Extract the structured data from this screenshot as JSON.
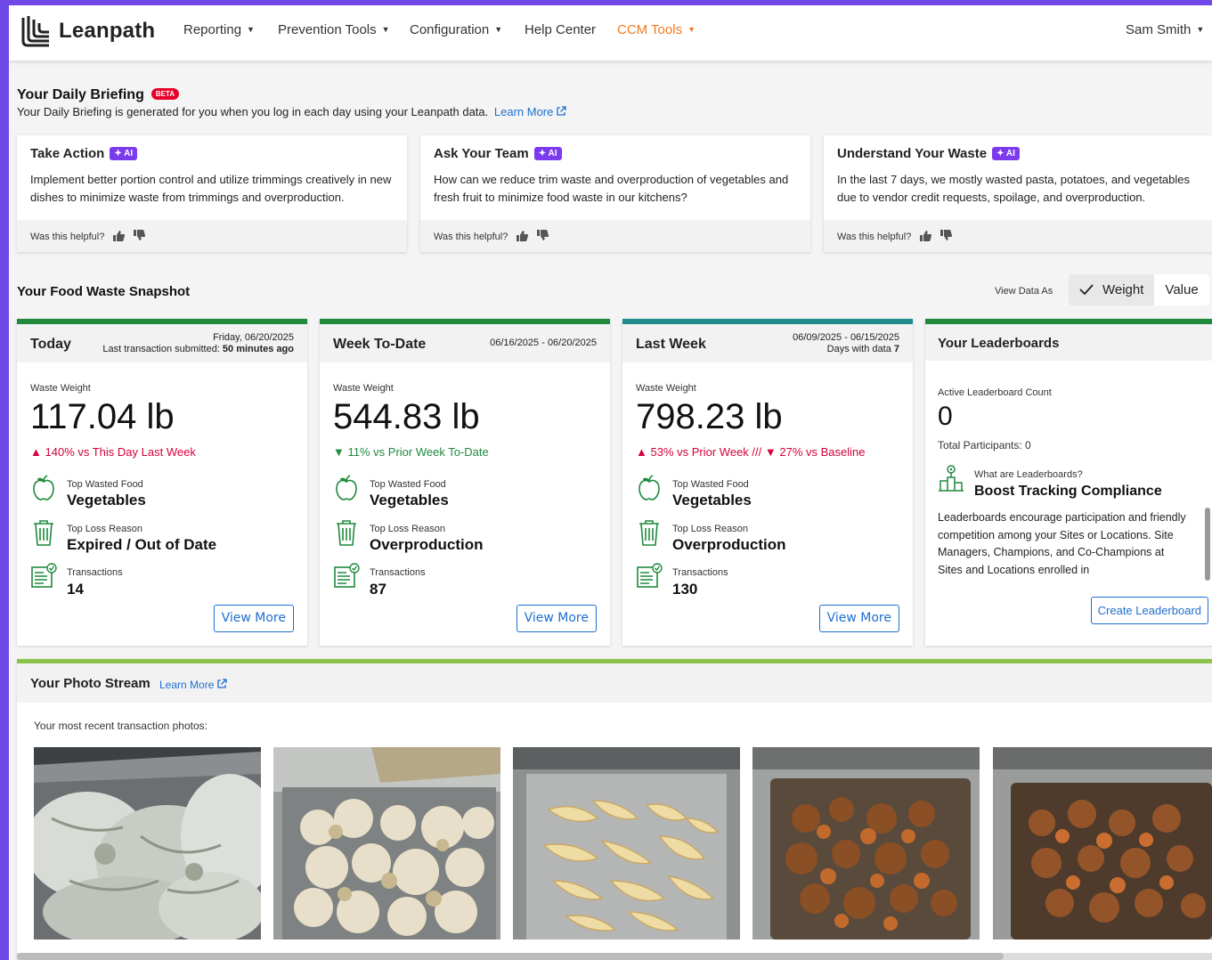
{
  "nav": {
    "brand": "Leanpath",
    "items": [
      {
        "label": "Reporting",
        "caret": true
      },
      {
        "label": "Prevention Tools",
        "caret": true
      },
      {
        "label": "Configuration",
        "caret": true
      },
      {
        "label": "Help Center",
        "caret": false
      },
      {
        "label": "CCM Tools",
        "caret": true
      }
    ],
    "user": "Sam Smith",
    "accent_color": "#f47b20"
  },
  "briefing": {
    "title": "Your Daily Briefing",
    "badge": "BETA",
    "subtitle": "Your Daily Briefing is generated for you when you log in each day using your Leanpath data.",
    "learn_more": "Learn More",
    "ai_badge": "AI",
    "helpful_text": "Was this helpful?",
    "cards": [
      {
        "title": "Take Action",
        "body": "Implement better portion control and utilize trimmings creatively in new dishes to minimize waste from trimmings and overproduction."
      },
      {
        "title": "Ask Your Team",
        "body": "How can we reduce trim waste and overproduction of vegetables and fresh fruit to minimize food waste in our kitchens?"
      },
      {
        "title": "Understand Your Waste",
        "body": "In the last 7 days, we mostly wasted pasta, potatoes, and vegetables due to vendor credit requests, spoilage, and overproduction."
      }
    ]
  },
  "snapshot": {
    "title": "Your Food Waste Snapshot",
    "view_data_as": "View Data As",
    "toggle": {
      "weight": "Weight",
      "value": "Value",
      "selected": "Weight"
    },
    "labels": {
      "waste_weight": "Waste Weight",
      "top_food": "Top Wasted Food",
      "top_loss": "Top Loss Reason",
      "transactions": "Transactions",
      "view_more": "View More"
    },
    "cards": [
      {
        "title": "Today",
        "meta_line1": "Friday, 06/20/2025",
        "meta_line2_prefix": "Last transaction submitted: ",
        "meta_line2_bold": "50 minutes ago",
        "weight": "117.04 lb",
        "delta": "140% vs This Day Last Week",
        "top_food": "Vegetables",
        "top_loss": "Expired / Out of Date",
        "transactions": "14"
      },
      {
        "title": "Week To-Date",
        "meta_line1": "06/16/2025 - 06/20/2025",
        "weight": "544.83 lb",
        "delta": "11% vs Prior Week To-Date",
        "top_food": "Vegetables",
        "top_loss": "Overproduction",
        "transactions": "87"
      },
      {
        "title": "Last Week",
        "meta_line1": "06/09/2025 - 06/15/2025",
        "meta_line2_prefix": "Days with data ",
        "meta_line2_bold": "7",
        "weight": "798.23 lb",
        "delta_a": "53% vs Prior Week",
        "delta_sep": "///",
        "delta_b": "27% vs Baseline",
        "top_food": "Vegetables",
        "top_loss": "Overproduction",
        "transactions": "130"
      }
    ]
  },
  "leaderboard": {
    "title": "Your Leaderboards",
    "count_label": "Active Leaderboard Count",
    "count": "0",
    "participants": "Total Participants: 0",
    "what_are": "What are Leaderboards?",
    "headline": "Boost Tracking Compliance",
    "description": "Leaderboards encourage participation and friendly competition among your Sites or Locations. Site Managers, Champions, and Co-Champions at Sites and Locations enrolled in",
    "create_button": "Create Leaderboard"
  },
  "photo_stream": {
    "title": "Your Photo Stream",
    "learn_more": "Learn More",
    "subtitle": "Your most recent transaction photos:",
    "photos": [
      "chicken-tray",
      "cauliflower-tray",
      "potato-wedges-tray",
      "roasted-sweet-potato-tray",
      "roasted-vegetables-tray"
    ]
  },
  "colors": {
    "green_up": "#1f8a3c",
    "red_up": "#d6003b",
    "link_blue": "#1e6fcf",
    "ai_purple": "#7c3aed",
    "photo_bar": "#8bc34a"
  }
}
